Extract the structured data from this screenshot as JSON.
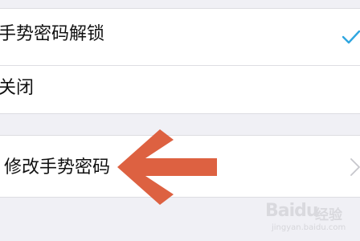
{
  "settings": {
    "gesture_unlock": {
      "label": "手势密码解锁",
      "selected": true,
      "icon": "check-icon"
    },
    "off": {
      "label": "关闭"
    },
    "modify_gesture": {
      "label": "修改手势密码",
      "icon": "chevron-right-icon"
    }
  },
  "annotation": {
    "icon": "arrow-left-icon",
    "color": "#dd6141"
  },
  "watermark": {
    "brand": "Baidu",
    "suffix": "经验",
    "url": "jingyan.baidu.com"
  },
  "colors": {
    "accent": "#2fa6e0",
    "background": "#f0f0f5"
  }
}
